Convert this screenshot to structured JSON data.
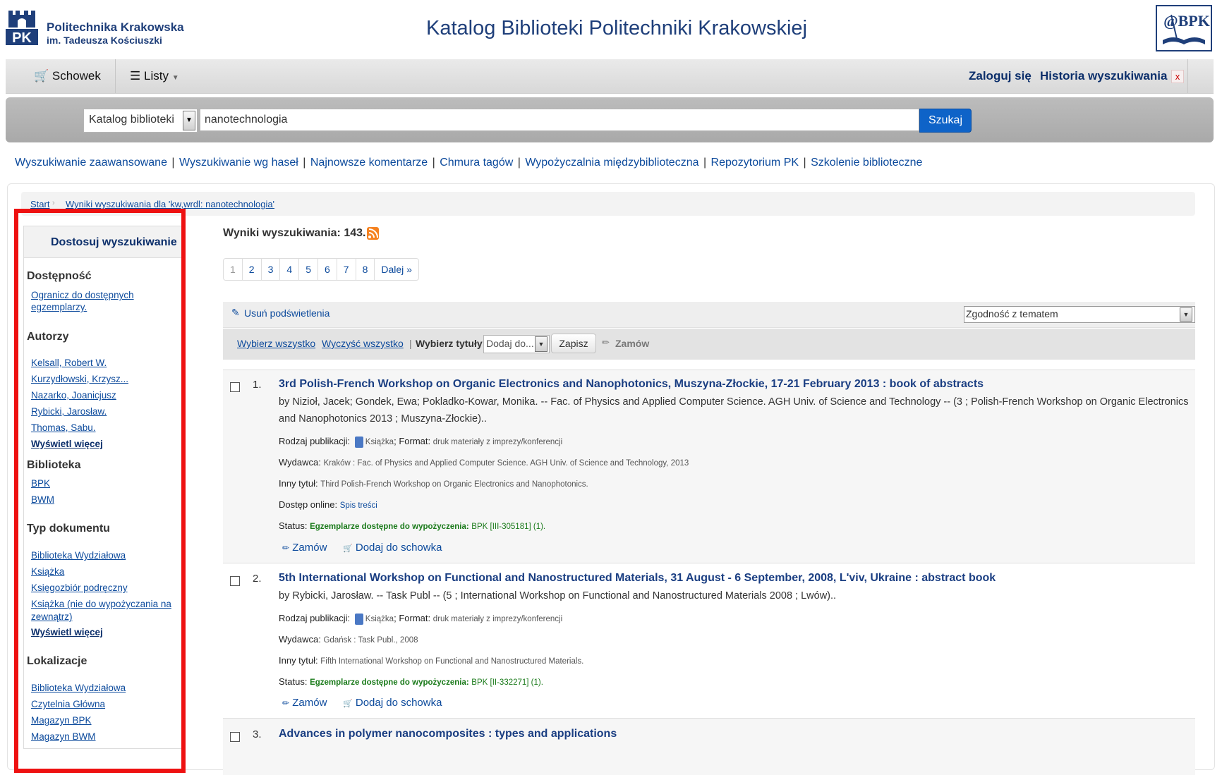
{
  "header": {
    "logo_line1": "Politechnika Krakowska",
    "logo_line2": "im. Tadeusza Kościuszki",
    "logo_mark": "PK",
    "title": "Katalog Biblioteki Politechniki Krakowskiej",
    "bpk_logo": "@BPK"
  },
  "nav": {
    "schowek": "Schowek",
    "listy": "Listy",
    "login": "Zaloguj się",
    "history": "Historia wyszukiwania",
    "history_clear": "x"
  },
  "search": {
    "scope": "Katalog biblioteki",
    "query": "nanotechnologia",
    "button": "Szukaj"
  },
  "links": [
    "Wyszukiwanie zaawansowane",
    "Wyszukiwanie wg haseł",
    "Najnowsze komentarze",
    "Chmura tagów",
    "Wypożyczalnia międzybiblioteczna",
    "Repozytorium PK",
    "Szkolenie biblioteczne"
  ],
  "breadcrumb": {
    "start": "Start",
    "current": "Wyniki wyszukiwania dla 'kw,wrdl: nanotechnologia'"
  },
  "sidebar": {
    "title": "Dostosuj wyszukiwanie",
    "availability": {
      "heading": "Dostępność",
      "link_line1": "Ogranicz do dostępnych",
      "link_line2": "egzemplarzy."
    },
    "authors": {
      "heading": "Autorzy",
      "items": [
        "Kelsall, Robert W.",
        "Kurzydłowski, Krzysz...",
        "Nazarko, Joanicjusz",
        "Rybicki, Jarosław.",
        "Thomas, Sabu."
      ],
      "more": "Wyświetl więcej"
    },
    "library": {
      "heading": "Biblioteka",
      "items": [
        "BPK",
        "BWM"
      ]
    },
    "doctype": {
      "heading": "Typ dokumentu",
      "items": [
        "Biblioteka Wydziałowa",
        "Książka",
        "Księgozbiór podręczny"
      ],
      "item4_line1": "Książka (nie do wypożyczania na",
      "item4_line2": "zewnątrz)",
      "more": "Wyświetl więcej"
    },
    "locations": {
      "heading": "Lokalizacje",
      "items": [
        "Biblioteka Wydziałowa",
        "Czytelnia Główna",
        "Magazyn BPK",
        "Magazyn BWM"
      ]
    }
  },
  "results": {
    "title": "Wyniki wyszukiwania: 143.",
    "pages": [
      "1",
      "2",
      "3",
      "4",
      "5",
      "6",
      "7",
      "8",
      "Dalej »"
    ],
    "unhighlight": "Usuń podświetlenia",
    "sort": "Zgodność z tematem",
    "select_all": "Wybierz wszystko",
    "clear_all": "Wyczyść wszystko",
    "choose_titles": "Wybierz tytuły:",
    "add_to": "Dodaj do...",
    "save": "Zapisz",
    "order": "Zamów",
    "labels": {
      "type": "Rodzaj publikacji:",
      "format": "Format:",
      "publisher": "Wydawca:",
      "other_title": "Inny tytuł:",
      "online": "Dostęp online:",
      "status": "Status:",
      "order": "Zamów",
      "add_to_cart": "Dodaj do schowka"
    },
    "items": [
      {
        "num": "1.",
        "title": "3rd Polish-French Workshop on Organic Electronics and Nanophotonics, Muszyna-Złockie, 17-21 February 2013 : book of abstracts",
        "by": "by Nizioł, Jacek; Gondek, Ewa; Pokladko-Kowar, Monika. -- Fac. of Physics and Applied Computer Science. AGH Univ. of Science and Technology -- (3 ; Polish-French Workshop on Organic Electronics and Nanophotonics 2013 ; Muszyna-Złockie)..",
        "type": "Książka",
        "format": "druk materiały z imprezy/konferencji",
        "publisher": "Kraków : Fac. of Physics and Applied Computer Science. AGH Univ. of Science and Technology, 2013",
        "other_title": "Third Polish-French Workshop on Organic Electronics and Nanophotonics.",
        "online": "Spis treści",
        "status_avail": "Egzemplarze dostępne do wypożyczenia:",
        "status_loc": "BPK [III-305181] (1)."
      },
      {
        "num": "2.",
        "title": "5th International Workshop on Functional and Nanostructured Materials, 31 August - 6 September, 2008, L'viv, Ukraine : abstract book",
        "by": "by Rybicki, Jarosław. -- Task Publ -- (5 ; International Workshop on Functional and Nanostructured Materials 2008 ; Lwów)..",
        "type": "Książka",
        "format": "druk materiały z imprezy/konferencji",
        "publisher": "Gdańsk : Task Publ., 2008",
        "other_title": "Fifth International Workshop on Functional and Nanostructured Materials.",
        "status_avail": "Egzemplarze dostępne do wypożyczenia:",
        "status_loc": "BPK [II-332271] (1)."
      },
      {
        "num": "3.",
        "title": "Advances in polymer nanocomposites : types and applications"
      }
    ]
  }
}
